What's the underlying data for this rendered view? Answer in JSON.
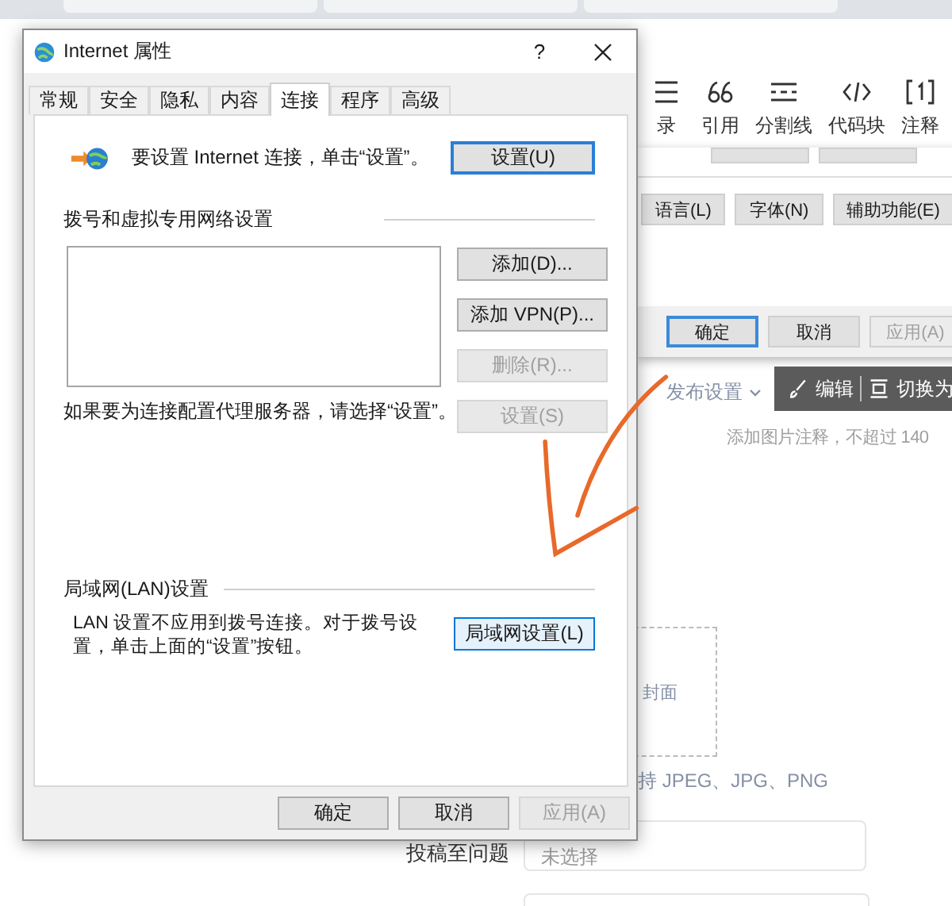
{
  "editor_toolbar": [
    {
      "kind": "list",
      "label": "录"
    },
    {
      "kind": "quote",
      "label": "引用"
    },
    {
      "kind": "divider",
      "label": "分割线"
    },
    {
      "kind": "code",
      "label": "代码块"
    },
    {
      "kind": "footnote",
      "label": "注释"
    }
  ],
  "back_dialog": {
    "buttons": [
      {
        "label": "语言(L)",
        "disabled": false
      },
      {
        "label": "字体(N)",
        "disabled": false
      },
      {
        "label": "辅助功能(E)",
        "disabled": false
      }
    ],
    "footer_buttons": [
      {
        "label": "确定",
        "default": true,
        "disabled": false
      },
      {
        "label": "取消",
        "default": false,
        "disabled": false
      },
      {
        "label": "应用(A)",
        "default": false,
        "disabled": true
      }
    ]
  },
  "page": {
    "publish_settings": "发布设置",
    "image_toolbar": [
      {
        "kind": "edit",
        "label": "编辑"
      },
      {
        "kind": "switch",
        "label": "切换为"
      }
    ],
    "caption_placeholder": "添加图片注释，不超过 140",
    "cover_label": "封面",
    "format_hint": "持 JPEG、JPG、PNG",
    "question_label": "投稿至问题",
    "question_select": "未选择"
  },
  "dialog": {
    "title": "Internet 属性",
    "help": "?",
    "tabs": [
      {
        "label": "常规",
        "selected": false
      },
      {
        "label": "安全",
        "selected": false
      },
      {
        "label": "隐私",
        "selected": false
      },
      {
        "label": "内容",
        "selected": false
      },
      {
        "label": "连接",
        "selected": true
      },
      {
        "label": "程序",
        "selected": false
      },
      {
        "label": "高级",
        "selected": false
      }
    ],
    "setup_text": "要设置 Internet 连接，单击“设置”。",
    "setup_button": {
      "label": "设置(U)",
      "default": true
    },
    "vpn_group": "拨号和虚拟专用网络设置",
    "vpn_buttons": [
      {
        "label": "添加(D)...",
        "disabled": false
      },
      {
        "label": "添加 VPN(P)...",
        "disabled": false
      },
      {
        "label": "删除(R)...",
        "disabled": true
      },
      {
        "label": "设置(S)",
        "disabled": true
      }
    ],
    "proxy_text": "如果要为连接配置代理服务器，请选择“设置”。",
    "lan_group": "局域网(LAN)设置",
    "lan_text": "LAN 设置不应用到拨号连接。对于拨号设置，单击上面的“设置”按钮。",
    "lan_button": {
      "label": "局域网设置(L)",
      "default": false
    },
    "footer_buttons": [
      {
        "label": "确定",
        "disabled": false
      },
      {
        "label": "取消",
        "disabled": false
      },
      {
        "label": "应用(A)",
        "disabled": true
      }
    ]
  }
}
